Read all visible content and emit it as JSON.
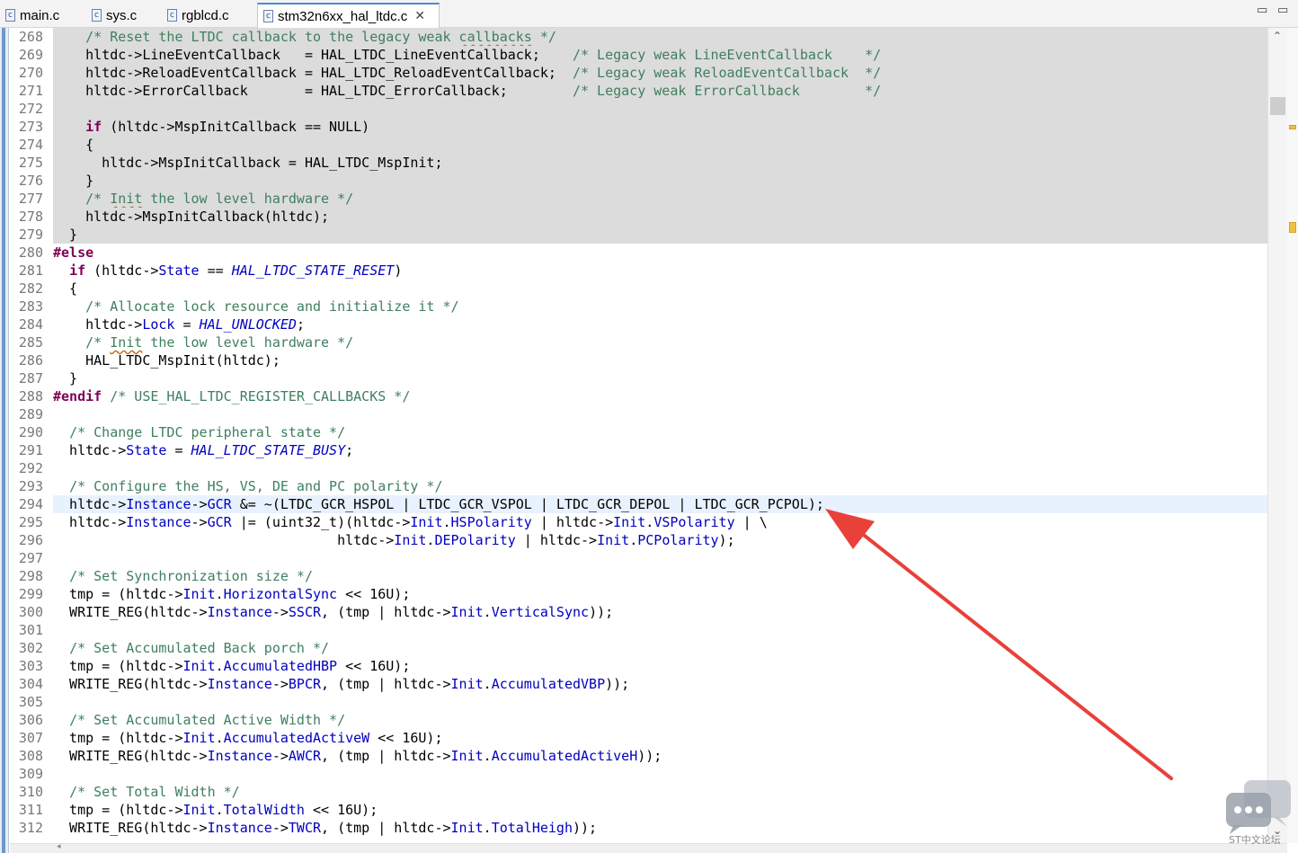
{
  "tabs": [
    {
      "label": "main.c",
      "icon": "c-file-icon"
    },
    {
      "label": "sys.c",
      "icon": "c-file-icon"
    },
    {
      "label": "rgblcd.c",
      "icon": "c-file-icon"
    },
    {
      "label": "stm32n6xx_hal_ltdc.c",
      "icon": "c-file-icon",
      "active": true
    }
  ],
  "file_icon_glyph": "c",
  "close_glyph": "✕",
  "window_buttons": {
    "minimize": "▭",
    "maximize": "▭"
  },
  "scroll": {
    "up": "⌃",
    "down": "⌄"
  },
  "lines": [
    {
      "n": "268",
      "inactive": true,
      "html": "    <span class=\"c\">/* Reset the LTDC callback to the legacy weak <span class=\"u\">callbacks</span> */</span>"
    },
    {
      "n": "269",
      "inactive": true,
      "html": "    hltdc->LineEventCallback   = HAL_LTDC_LineEventCallback;    <span class=\"c\">/* Legacy weak LineEventCallback    */</span>"
    },
    {
      "n": "270",
      "inactive": true,
      "html": "    hltdc->ReloadEventCallback = HAL_LTDC_ReloadEventCallback;  <span class=\"c\">/* Legacy weak ReloadEventCallback  */</span>"
    },
    {
      "n": "271",
      "inactive": true,
      "html": "    hltdc->ErrorCallback       = HAL_LTDC_ErrorCallback;        <span class=\"c\">/* Legacy weak ErrorCallback        */</span>"
    },
    {
      "n": "272",
      "inactive": true,
      "html": ""
    },
    {
      "n": "273",
      "inactive": true,
      "html": "    <span class=\"k\">if</span> (hltdc->MspInitCallback == NULL)"
    },
    {
      "n": "274",
      "inactive": true,
      "html": "    {"
    },
    {
      "n": "275",
      "inactive": true,
      "html": "      hltdc->MspInitCallback = HAL_LTDC_MspInit;"
    },
    {
      "n": "276",
      "inactive": true,
      "html": "    }"
    },
    {
      "n": "277",
      "inactive": true,
      "html": "    <span class=\"c\">/* <span class=\"u\">Init</span> the low level hardware */</span>"
    },
    {
      "n": "278",
      "inactive": true,
      "html": "    hltdc->MspInitCallback(hltdc);"
    },
    {
      "n": "279",
      "inactive": true,
      "html": "  }"
    },
    {
      "n": "280",
      "html": "<span class=\"k\">#else</span>"
    },
    {
      "n": "281",
      "html": "  <span class=\"k\">if</span> (hltdc-><span class=\"f\">State</span> == <span class=\"m\">HAL_LTDC_STATE_RESET</span>)"
    },
    {
      "n": "282",
      "html": "  {"
    },
    {
      "n": "283",
      "html": "    <span class=\"c\">/* Allocate lock resource and initialize it */</span>"
    },
    {
      "n": "284",
      "html": "    hltdc-><span class=\"f\">Lock</span> = <span class=\"m\">HAL_UNLOCKED</span>;"
    },
    {
      "n": "285",
      "html": "    <span class=\"c\">/* <span class=\"u\">Init</span> the low level hardware */</span>"
    },
    {
      "n": "286",
      "html": "    HAL_LTDC_MspInit(hltdc);"
    },
    {
      "n": "287",
      "html": "  }"
    },
    {
      "n": "288",
      "html": "<span class=\"k\">#endif</span> <span class=\"c\">/* USE_HAL_LTDC_REGISTER_CALLBACKS */</span>"
    },
    {
      "n": "289",
      "html": ""
    },
    {
      "n": "290",
      "html": "  <span class=\"c\">/* Change LTDC peripheral state */</span>"
    },
    {
      "n": "291",
      "html": "  hltdc-><span class=\"f\">State</span> = <span class=\"m\">HAL_LTDC_STATE_BUSY</span>;"
    },
    {
      "n": "292",
      "html": ""
    },
    {
      "n": "293",
      "html": "  <span class=\"c\">/* Configure the HS, VS, DE and PC polarity */</span>"
    },
    {
      "n": "294",
      "current": true,
      "html": "  hltdc-><span class=\"f\">Instance</span>-><span class=\"f\">GCR</span> &amp;= ~(LTDC_GCR_HSPOL | LTDC_GCR_VSPOL | LTDC_GCR_DEPOL | LTDC_GCR_PCPOL);"
    },
    {
      "n": "295",
      "html": "  hltdc-><span class=\"f\">Instance</span>-><span class=\"f\">GCR</span> |= (uint32_t)(hltdc-><span class=\"f\">Init</span>.<span class=\"f\">HSPolarity</span> | hltdc-><span class=\"f\">Init</span>.<span class=\"f\">VSPolarity</span> | \\"
    },
    {
      "n": "296",
      "html": "                                   hltdc-><span class=\"f\">Init</span>.<span class=\"f\">DEPolarity</span> | hltdc-><span class=\"f\">Init</span>.<span class=\"f\">PCPolarity</span>);"
    },
    {
      "n": "297",
      "html": ""
    },
    {
      "n": "298",
      "html": "  <span class=\"c\">/* Set Synchronization size */</span>"
    },
    {
      "n": "299",
      "html": "  tmp = (hltdc-><span class=\"f\">Init</span>.<span class=\"f\">HorizontalSync</span> &lt;&lt; 16U);"
    },
    {
      "n": "300",
      "html": "  WRITE_REG(hltdc-><span class=\"f\">Instance</span>-><span class=\"f\">SSCR</span>, (tmp | hltdc-><span class=\"f\">Init</span>.<span class=\"f\">VerticalSync</span>));"
    },
    {
      "n": "301",
      "html": ""
    },
    {
      "n": "302",
      "html": "  <span class=\"c\">/* Set Accumulated Back porch */</span>"
    },
    {
      "n": "303",
      "html": "  tmp = (hltdc-><span class=\"f\">Init</span>.<span class=\"f\">AccumulatedHBP</span> &lt;&lt; 16U);"
    },
    {
      "n": "304",
      "html": "  WRITE_REG(hltdc-><span class=\"f\">Instance</span>-><span class=\"f\">BPCR</span>, (tmp | hltdc-><span class=\"f\">Init</span>.<span class=\"f\">AccumulatedVBP</span>));"
    },
    {
      "n": "305",
      "html": ""
    },
    {
      "n": "306",
      "html": "  <span class=\"c\">/* Set Accumulated Active Width */</span>"
    },
    {
      "n": "307",
      "html": "  tmp = (hltdc-><span class=\"f\">Init</span>.<span class=\"f\">AccumulatedActiveW</span> &lt;&lt; 16U);"
    },
    {
      "n": "308",
      "html": "  WRITE_REG(hltdc-><span class=\"f\">Instance</span>-><span class=\"f\">AWCR</span>, (tmp | hltdc-><span class=\"f\">Init</span>.<span class=\"f\">AccumulatedActiveH</span>));"
    },
    {
      "n": "309",
      "html": ""
    },
    {
      "n": "310",
      "html": "  <span class=\"c\">/* Set Total Width */</span>"
    },
    {
      "n": "311",
      "html": "  tmp = (hltdc-><span class=\"f\">Init</span>.<span class=\"f\">TotalWidth</span> &lt;&lt; 16U);"
    },
    {
      "n": "312",
      "html": "  WRITE_REG(hltdc-><span class=\"f\">Instance</span>-><span class=\"f\">TWCR</span>, (tmp | hltdc-><span class=\"f\">Init</span>.<span class=\"f\">TotalHeigh</span>));"
    }
  ],
  "colors": {
    "comment": "#3f7f5f",
    "keyword": "#7f0055",
    "field": "#0000c0",
    "inactive_bg": "#dcdcdc",
    "current_line_bg": "#e8f2fe",
    "annotation_arrow": "#e8413a"
  },
  "watermark": {
    "text": "ST中文论坛",
    "icon": "chat-bubbles-icon"
  }
}
